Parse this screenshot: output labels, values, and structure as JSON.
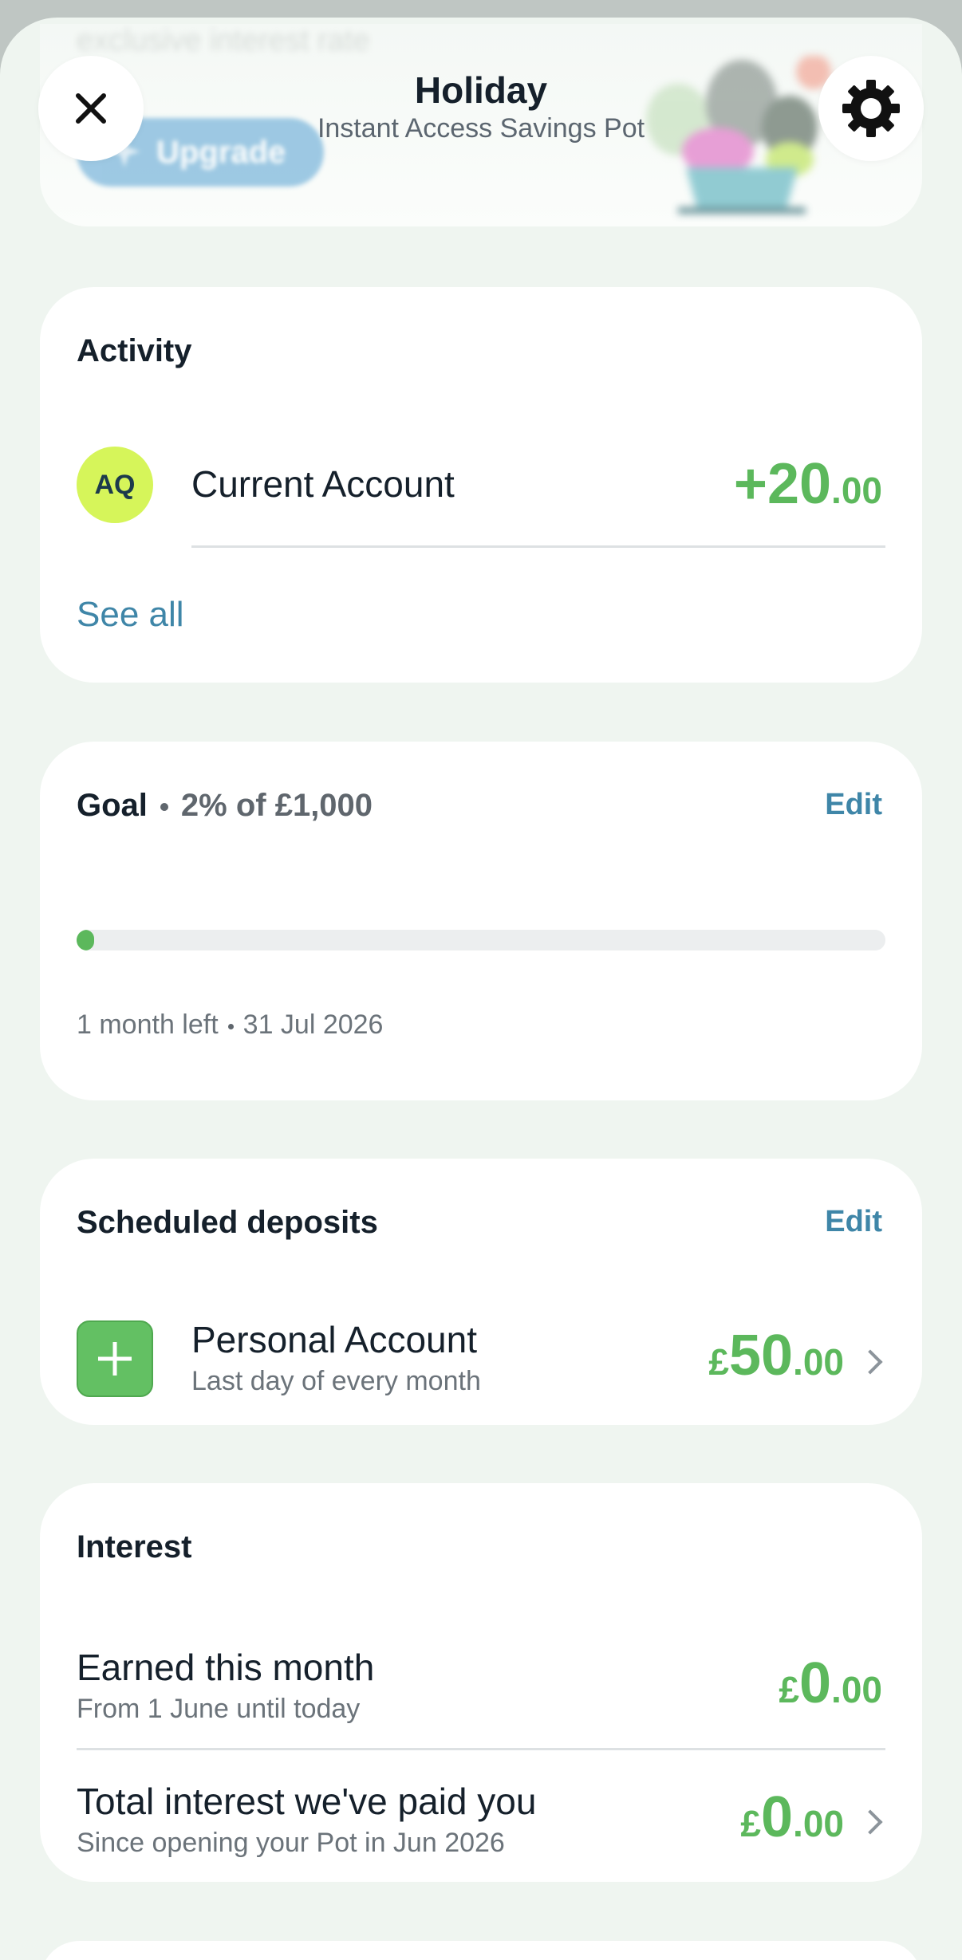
{
  "promo": {
    "faded_text": "exclusive interest rate",
    "upgrade_label": "Upgrade"
  },
  "header": {
    "title": "Holiday",
    "subtitle": "Instant Access Savings Pot",
    "close_icon": "close-icon",
    "settings_icon": "gear-icon"
  },
  "activity": {
    "title": "Activity",
    "items": [
      {
        "avatar": "AQ",
        "label": "Current Account",
        "amount_main": "+20",
        "amount_pence": ".00"
      }
    ],
    "see_all": "See all"
  },
  "goal": {
    "title": "Goal",
    "summary": "2% of £1,000",
    "edit": "Edit",
    "progress_fraction": 0.02,
    "time_left": "1 month left",
    "date": "31 Jul 2026"
  },
  "scheduled": {
    "title": "Scheduled deposits",
    "edit": "Edit",
    "items": [
      {
        "label": "Personal Account",
        "sub": "Last day of every month",
        "currency": "£",
        "amount_main": "50",
        "amount_pence": ".00",
        "icon": "plus-icon"
      }
    ]
  },
  "interest": {
    "title": "Interest",
    "rows": [
      {
        "label": "Earned this month",
        "sub": "From 1 June until today",
        "currency": "£",
        "amount_main": "0",
        "amount_pence": ".00"
      },
      {
        "label": "Total interest we've paid you",
        "sub": "Since opening your Pot in Jun 2026",
        "currency": "£",
        "amount_main": "0",
        "amount_pence": ".00"
      }
    ]
  },
  "colors": {
    "accent_green": "#5cb85c",
    "link_blue": "#3f86a8",
    "avatar_lime": "#d6f55a",
    "background": "#eff5f0"
  }
}
